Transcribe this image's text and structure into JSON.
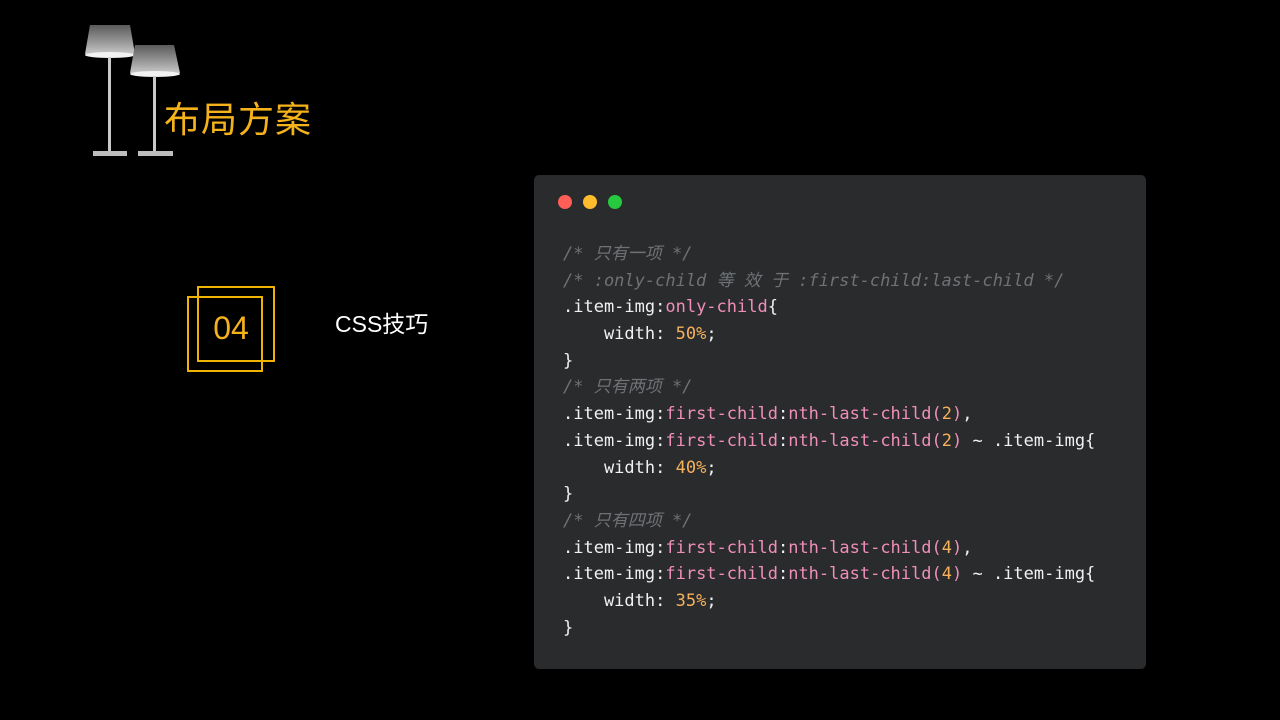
{
  "slide": {
    "title": "布局方案",
    "section_number": "04",
    "section_label": "CSS技巧"
  },
  "colors": {
    "background": "#000000",
    "accent": "#f5b21a",
    "code_bg": "#2a2b2d",
    "comment": "#6f7275",
    "pseudo": "#ef8fb9",
    "number": "#f7b15a",
    "dot_red": "#ff5f56",
    "dot_yellow": "#ffbd2e",
    "dot_green": "#27c93f"
  },
  "code": [
    [
      {
        "t": "comment",
        "v": "/* 只有一项 */"
      }
    ],
    [
      {
        "t": "comment",
        "v": "/* :only-child 等 效 于 :first-child:last-child */"
      }
    ],
    [
      {
        "t": "plain",
        "v": ".item-img:"
      },
      {
        "t": "pseudo",
        "v": "only-child"
      },
      {
        "t": "plain",
        "v": "{"
      }
    ],
    [
      {
        "t": "plain",
        "v": "    width: "
      },
      {
        "t": "number",
        "v": "50%"
      },
      {
        "t": "plain",
        "v": ";"
      }
    ],
    [
      {
        "t": "plain",
        "v": "}"
      }
    ],
    [
      {
        "t": "comment",
        "v": "/* 只有两项 */"
      }
    ],
    [
      {
        "t": "plain",
        "v": ".item-img:"
      },
      {
        "t": "pseudo",
        "v": "first-child"
      },
      {
        "t": "plain",
        "v": ":"
      },
      {
        "t": "pseudo",
        "v": "nth-last-child("
      },
      {
        "t": "number",
        "v": "2"
      },
      {
        "t": "pseudo",
        "v": ")"
      },
      {
        "t": "plain",
        "v": ","
      }
    ],
    [
      {
        "t": "plain",
        "v": ".item-img:"
      },
      {
        "t": "pseudo",
        "v": "first-child"
      },
      {
        "t": "plain",
        "v": ":"
      },
      {
        "t": "pseudo",
        "v": "nth-last-child("
      },
      {
        "t": "number",
        "v": "2"
      },
      {
        "t": "pseudo",
        "v": ")"
      },
      {
        "t": "plain",
        "v": " ~ .item-img{"
      }
    ],
    [
      {
        "t": "plain",
        "v": "    width: "
      },
      {
        "t": "number",
        "v": "40%"
      },
      {
        "t": "plain",
        "v": ";"
      }
    ],
    [
      {
        "t": "plain",
        "v": "}"
      }
    ],
    [
      {
        "t": "comment",
        "v": "/* 只有四项 */"
      }
    ],
    [
      {
        "t": "plain",
        "v": ".item-img:"
      },
      {
        "t": "pseudo",
        "v": "first-child"
      },
      {
        "t": "plain",
        "v": ":"
      },
      {
        "t": "pseudo",
        "v": "nth-last-child("
      },
      {
        "t": "number",
        "v": "4"
      },
      {
        "t": "pseudo",
        "v": ")"
      },
      {
        "t": "plain",
        "v": ","
      }
    ],
    [
      {
        "t": "plain",
        "v": ".item-img:"
      },
      {
        "t": "pseudo",
        "v": "first-child"
      },
      {
        "t": "plain",
        "v": ":"
      },
      {
        "t": "pseudo",
        "v": "nth-last-child("
      },
      {
        "t": "number",
        "v": "4"
      },
      {
        "t": "pseudo",
        "v": ")"
      },
      {
        "t": "plain",
        "v": " ~ .item-img{"
      }
    ],
    [
      {
        "t": "plain",
        "v": "    width: "
      },
      {
        "t": "number",
        "v": "35%"
      },
      {
        "t": "plain",
        "v": ";"
      }
    ],
    [
      {
        "t": "plain",
        "v": "}"
      }
    ]
  ]
}
